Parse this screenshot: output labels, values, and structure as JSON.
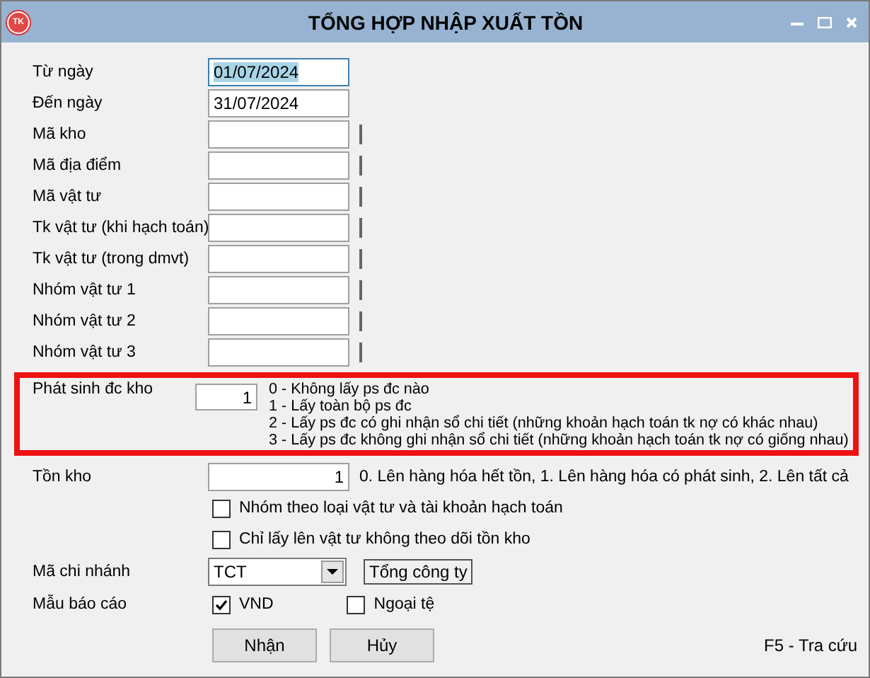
{
  "window": {
    "title": "TỔNG HỢP NHẬP XUẤT TỒN",
    "logo": "TK"
  },
  "fields": [
    {
      "label": "Từ ngày",
      "value": "01/07/2024",
      "selected": true,
      "lookup": false
    },
    {
      "label": "Đến ngày",
      "value": "31/07/2024",
      "selected": false,
      "lookup": false
    },
    {
      "label": "Mã kho",
      "selected": false,
      "lookup": true
    },
    {
      "label": "Mã địa điểm",
      "selected": false,
      "lookup": true
    },
    {
      "label": "Mã vật tư",
      "selected": false,
      "lookup": true
    },
    {
      "label": "Tk vật tư (khi hạch toán)",
      "selected": false,
      "lookup": true
    },
    {
      "label": "Tk vật tư (trong dmvt)",
      "selected": false,
      "lookup": true
    },
    {
      "label": "Nhóm vật tư 1",
      "selected": false,
      "lookup": true
    },
    {
      "label": "Nhóm vật tư 2",
      "selected": false,
      "lookup": true
    },
    {
      "label": "Nhóm vật tư 3",
      "selected": false,
      "lookup": true
    }
  ],
  "transfer": {
    "label": "Phát sinh đc kho",
    "value": "1",
    "highlighted": true,
    "options": [
      "0 - Không lấy ps đc nào",
      "1 - Lấy toàn bộ ps đc",
      "2 - Lấy ps đc có ghi nhận sổ chi tiết (những khoản hạch toán tk nợ có khác nhau)",
      "3 - Lấy ps đc không ghi nhận sổ chi tiết (những khoản hạch toán tk nợ có giống nhau)"
    ]
  },
  "stock": {
    "label": "Tồn kho",
    "value": "1",
    "hint": "0. Lên hàng hóa hết tồn, 1. Lên hàng hóa có phát sinh, 2. Lên tất cả"
  },
  "options": [
    {
      "label": "Nhóm theo loại vật tư và tài khoản hạch toán",
      "checked": false
    },
    {
      "label": "Chỉ lấy lên vật tư không theo dõi tồn kho",
      "checked": false
    }
  ],
  "branch": {
    "label": "Mã chi nhánh",
    "value": "TCT",
    "name": "Tổng công ty"
  },
  "report": {
    "label": "Mẫu báo cáo",
    "choices": [
      {
        "label": "VND",
        "checked": true
      },
      {
        "label": "Ngoại tệ",
        "checked": false
      }
    ]
  },
  "buttons": [
    "Nhận",
    "Hủy"
  ],
  "shortcut": "F5 - Tra cứu"
}
